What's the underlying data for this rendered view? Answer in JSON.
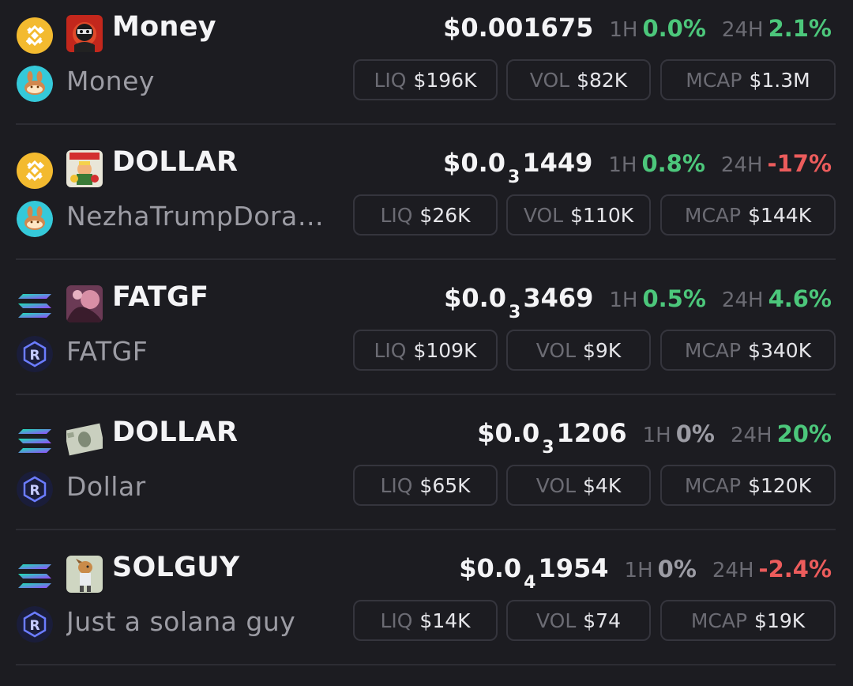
{
  "tokens": [
    {
      "chain_icon": "bnb-chain-icon",
      "dex_icon": "pancakeswap-icon",
      "symbol": "Money",
      "name": "Money",
      "price_prefix": "$0.001675",
      "price_subscript": "",
      "price_tail": "",
      "h1_label": "1H",
      "h1_value": "0.0%",
      "h1_trend": "up",
      "h24_label": "24H",
      "h24_value": "2.1%",
      "h24_trend": "up",
      "liq_label": "LIQ",
      "liq_value": "$196K",
      "vol_label": "VOL",
      "vol_value": "$82K",
      "mcap_label": "MCAP",
      "mcap_value": "$1.3M"
    },
    {
      "chain_icon": "bnb-chain-icon",
      "dex_icon": "pancakeswap-icon",
      "symbol": "DOLLAR",
      "name": "NezhaTrumpDorae…",
      "price_prefix": "$0.0",
      "price_subscript": "3",
      "price_tail": "1449",
      "h1_label": "1H",
      "h1_value": "0.8%",
      "h1_trend": "up",
      "h24_label": "24H",
      "h24_value": "-17%",
      "h24_trend": "down",
      "liq_label": "LIQ",
      "liq_value": "$26K",
      "vol_label": "VOL",
      "vol_value": "$110K",
      "mcap_label": "MCAP",
      "mcap_value": "$144K"
    },
    {
      "chain_icon": "solana-chain-icon",
      "dex_icon": "raydium-icon",
      "symbol": "FATGF",
      "name": "FATGF",
      "price_prefix": "$0.0",
      "price_subscript": "3",
      "price_tail": "3469",
      "h1_label": "1H",
      "h1_value": "0.5%",
      "h1_trend": "up",
      "h24_label": "24H",
      "h24_value": "4.6%",
      "h24_trend": "up",
      "liq_label": "LIQ",
      "liq_value": "$109K",
      "vol_label": "VOL",
      "vol_value": "$9K",
      "mcap_label": "MCAP",
      "mcap_value": "$340K"
    },
    {
      "chain_icon": "solana-chain-icon",
      "dex_icon": "raydium-icon",
      "symbol": "DOLLAR",
      "name": "Dollar",
      "price_prefix": "$0.0",
      "price_subscript": "3",
      "price_tail": "1206",
      "h1_label": "1H",
      "h1_value": "0%",
      "h1_trend": "flat",
      "h24_label": "24H",
      "h24_value": "20%",
      "h24_trend": "up",
      "liq_label": "LIQ",
      "liq_value": "$65K",
      "vol_label": "VOL",
      "vol_value": "$4K",
      "mcap_label": "MCAP",
      "mcap_value": "$120K"
    },
    {
      "chain_icon": "solana-chain-icon",
      "dex_icon": "raydium-icon",
      "symbol": "SOLGUY",
      "name": "Just a solana guy",
      "price_prefix": "$0.0",
      "price_subscript": "4",
      "price_tail": "1954",
      "h1_label": "1H",
      "h1_value": "0%",
      "h1_trend": "flat",
      "h24_label": "24H",
      "h24_value": "-2.4%",
      "h24_trend": "down",
      "liq_label": "LIQ",
      "liq_value": "$14K",
      "vol_label": "VOL",
      "vol_value": "$74",
      "mcap_label": "MCAP",
      "mcap_value": "$19K"
    }
  ],
  "colors": {
    "background": "#1c1c21",
    "positive": "#4cc77b",
    "negative": "#ec5c5c",
    "muted": "#6b6b73",
    "bnb": "#f3ba2f",
    "pancakeswap": "#35c9d9"
  }
}
